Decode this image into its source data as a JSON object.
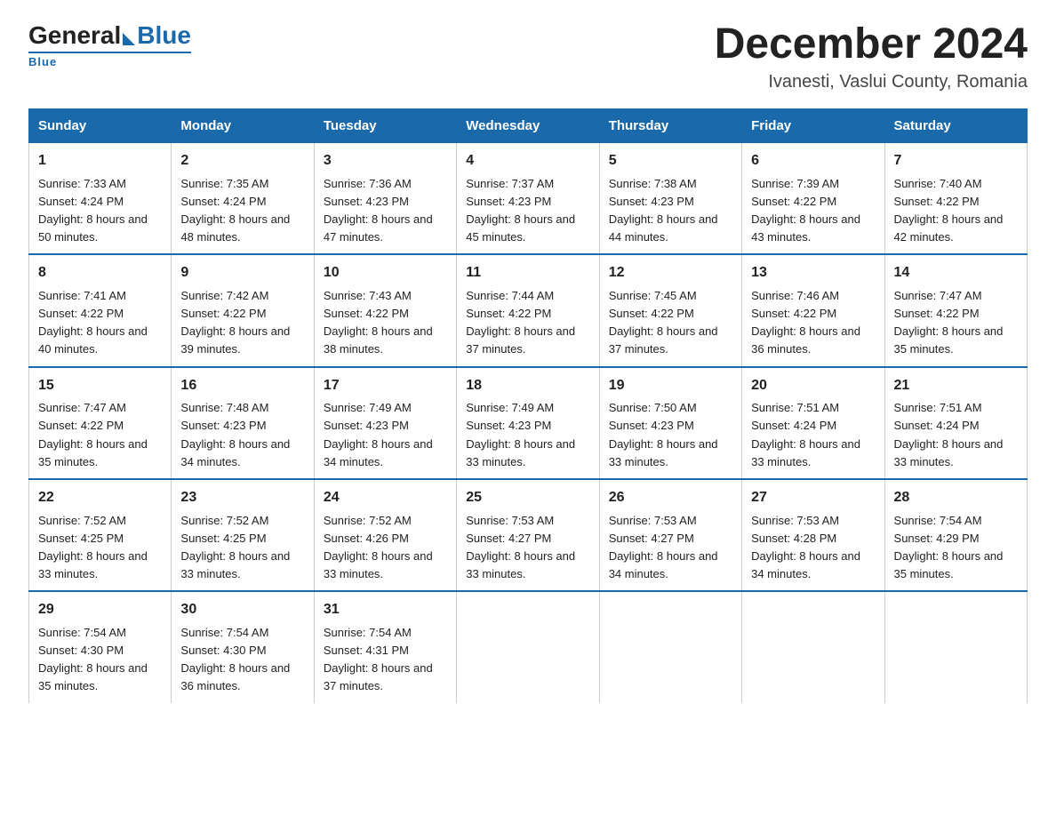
{
  "logo": {
    "general": "General",
    "blue": "Blue",
    "underline": "Blue"
  },
  "title": "December 2024",
  "subtitle": "Ivanesti, Vaslui County, Romania",
  "days_header": [
    "Sunday",
    "Monday",
    "Tuesday",
    "Wednesday",
    "Thursday",
    "Friday",
    "Saturday"
  ],
  "weeks": [
    [
      {
        "num": "1",
        "sunrise": "7:33 AM",
        "sunset": "4:24 PM",
        "daylight": "8 hours and 50 minutes."
      },
      {
        "num": "2",
        "sunrise": "7:35 AM",
        "sunset": "4:24 PM",
        "daylight": "8 hours and 48 minutes."
      },
      {
        "num": "3",
        "sunrise": "7:36 AM",
        "sunset": "4:23 PM",
        "daylight": "8 hours and 47 minutes."
      },
      {
        "num": "4",
        "sunrise": "7:37 AM",
        "sunset": "4:23 PM",
        "daylight": "8 hours and 45 minutes."
      },
      {
        "num": "5",
        "sunrise": "7:38 AM",
        "sunset": "4:23 PM",
        "daylight": "8 hours and 44 minutes."
      },
      {
        "num": "6",
        "sunrise": "7:39 AM",
        "sunset": "4:22 PM",
        "daylight": "8 hours and 43 minutes."
      },
      {
        "num": "7",
        "sunrise": "7:40 AM",
        "sunset": "4:22 PM",
        "daylight": "8 hours and 42 minutes."
      }
    ],
    [
      {
        "num": "8",
        "sunrise": "7:41 AM",
        "sunset": "4:22 PM",
        "daylight": "8 hours and 40 minutes."
      },
      {
        "num": "9",
        "sunrise": "7:42 AM",
        "sunset": "4:22 PM",
        "daylight": "8 hours and 39 minutes."
      },
      {
        "num": "10",
        "sunrise": "7:43 AM",
        "sunset": "4:22 PM",
        "daylight": "8 hours and 38 minutes."
      },
      {
        "num": "11",
        "sunrise": "7:44 AM",
        "sunset": "4:22 PM",
        "daylight": "8 hours and 37 minutes."
      },
      {
        "num": "12",
        "sunrise": "7:45 AM",
        "sunset": "4:22 PM",
        "daylight": "8 hours and 37 minutes."
      },
      {
        "num": "13",
        "sunrise": "7:46 AM",
        "sunset": "4:22 PM",
        "daylight": "8 hours and 36 minutes."
      },
      {
        "num": "14",
        "sunrise": "7:47 AM",
        "sunset": "4:22 PM",
        "daylight": "8 hours and 35 minutes."
      }
    ],
    [
      {
        "num": "15",
        "sunrise": "7:47 AM",
        "sunset": "4:22 PM",
        "daylight": "8 hours and 35 minutes."
      },
      {
        "num": "16",
        "sunrise": "7:48 AM",
        "sunset": "4:23 PM",
        "daylight": "8 hours and 34 minutes."
      },
      {
        "num": "17",
        "sunrise": "7:49 AM",
        "sunset": "4:23 PM",
        "daylight": "8 hours and 34 minutes."
      },
      {
        "num": "18",
        "sunrise": "7:49 AM",
        "sunset": "4:23 PM",
        "daylight": "8 hours and 33 minutes."
      },
      {
        "num": "19",
        "sunrise": "7:50 AM",
        "sunset": "4:23 PM",
        "daylight": "8 hours and 33 minutes."
      },
      {
        "num": "20",
        "sunrise": "7:51 AM",
        "sunset": "4:24 PM",
        "daylight": "8 hours and 33 minutes."
      },
      {
        "num": "21",
        "sunrise": "7:51 AM",
        "sunset": "4:24 PM",
        "daylight": "8 hours and 33 minutes."
      }
    ],
    [
      {
        "num": "22",
        "sunrise": "7:52 AM",
        "sunset": "4:25 PM",
        "daylight": "8 hours and 33 minutes."
      },
      {
        "num": "23",
        "sunrise": "7:52 AM",
        "sunset": "4:25 PM",
        "daylight": "8 hours and 33 minutes."
      },
      {
        "num": "24",
        "sunrise": "7:52 AM",
        "sunset": "4:26 PM",
        "daylight": "8 hours and 33 minutes."
      },
      {
        "num": "25",
        "sunrise": "7:53 AM",
        "sunset": "4:27 PM",
        "daylight": "8 hours and 33 minutes."
      },
      {
        "num": "26",
        "sunrise": "7:53 AM",
        "sunset": "4:27 PM",
        "daylight": "8 hours and 34 minutes."
      },
      {
        "num": "27",
        "sunrise": "7:53 AM",
        "sunset": "4:28 PM",
        "daylight": "8 hours and 34 minutes."
      },
      {
        "num": "28",
        "sunrise": "7:54 AM",
        "sunset": "4:29 PM",
        "daylight": "8 hours and 35 minutes."
      }
    ],
    [
      {
        "num": "29",
        "sunrise": "7:54 AM",
        "sunset": "4:30 PM",
        "daylight": "8 hours and 35 minutes."
      },
      {
        "num": "30",
        "sunrise": "7:54 AM",
        "sunset": "4:30 PM",
        "daylight": "8 hours and 36 minutes."
      },
      {
        "num": "31",
        "sunrise": "7:54 AM",
        "sunset": "4:31 PM",
        "daylight": "8 hours and 37 minutes."
      },
      null,
      null,
      null,
      null
    ]
  ]
}
